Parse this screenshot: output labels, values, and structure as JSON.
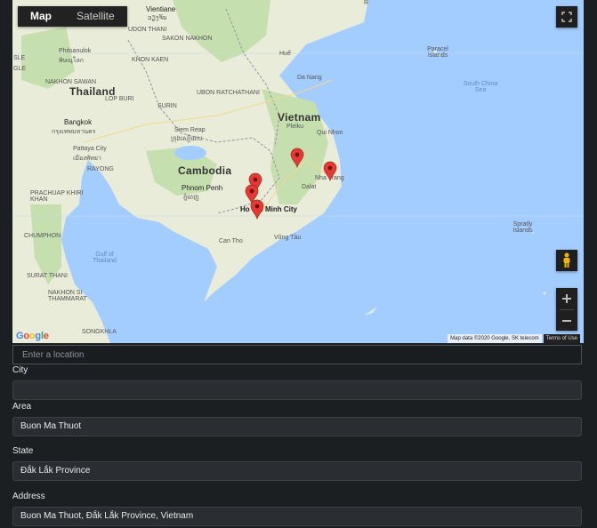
{
  "map": {
    "type_buttons": [
      "Map",
      "Satellite"
    ],
    "active_type": "Map",
    "icons": {
      "fullscreen": "fullscreen-icon",
      "pegman": "pegman-icon",
      "zoom_in": "zoom-in-icon",
      "zoom_out": "zoom-out-icon"
    },
    "labels": {
      "vientiane": "Vientiane",
      "vientiane_local": "ວຽງຈັນ",
      "udon": "UDON THANI",
      "sakon": "SAKON NAKHON",
      "phitsanulok": "Phitsanulok",
      "phitsanulok_local": "พิษณุโลก",
      "khon_kaen": "KHON KAEN",
      "nakhon_sawan": "NAKHON SAWAN",
      "thailand": "Thailand",
      "lop_buri": "LOP BURI",
      "ubon": "UBON RATCHATHANI",
      "surin": "SURIN",
      "bangkok": "Bangkok",
      "bangkok_local": "กรุงเทพมหานคร",
      "pattaya": "Pattaya City",
      "pattaya_local": "เมืองพัทยา",
      "rayong": "RAYONG",
      "siem_reap": "Siem Reap",
      "siem_reap_local": "ក្រុងសៀមរាប",
      "cambodia": "Cambodia",
      "phnom_penh": "Phnom Penh",
      "phnom_penh_local": "ភ្នំពេញ",
      "hue": "Huế",
      "da_nang": "Da Nang",
      "vietnam": "Vietnam",
      "pleiku": "Pleiku",
      "qui_nhon": "Qui Nhon",
      "dalat": "Dalat",
      "nha_trang": "Nha Trang",
      "hcmc": "Ho Chi Minh City",
      "vung_tau": "Vũng Tàu",
      "can_tho": "Can Tho",
      "prachuap": "PRACHUAP KHIRI KHAN",
      "chumphon": "CHUMPHON",
      "surat": "SURAT THANI",
      "nakhon_si": "NAKHON SI THAMMARAT",
      "songkhla": "SONGKHLA",
      "gulf": "Gulf of Thailand",
      "paracel": "Paracel Islands",
      "south_china_sea": "South China Sea",
      "spratly": "Spratly Islands",
      "sle": "SLE",
      "gle": "GLE",
      "r": "R"
    },
    "google_logo": "Google",
    "attribution": "Map data ©2020 Google, SK telecom",
    "terms": "Terms of Use"
  },
  "location_input": {
    "placeholder": "Enter a location",
    "value": ""
  },
  "fields": {
    "city": {
      "label": "City",
      "value": ""
    },
    "area": {
      "label": "Area",
      "value": "Buon Ma Thuot"
    },
    "state": {
      "label": "State",
      "value": "Đắk Lắk Province"
    },
    "address": {
      "label": "Address",
      "value": "Buon Ma Thuot, Đắk Lắk Province, Vietnam"
    }
  },
  "colors": {
    "marker": "#e53935",
    "sea": "#a3ccff",
    "land": "#e8ecd8",
    "forest": "#c6dfae",
    "background": "#1b1f22"
  }
}
